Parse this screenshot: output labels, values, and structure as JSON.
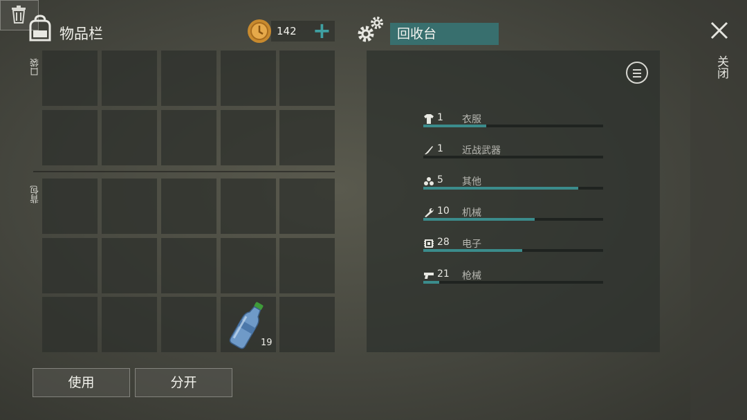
{
  "inventory": {
    "title": "物品栏",
    "coins": "142",
    "sections": {
      "pocket": "口袋",
      "backpack": "背包"
    },
    "item": {
      "name": "water-bottle",
      "quantity": "19"
    },
    "buttons": {
      "use": "使用",
      "split": "分开"
    }
  },
  "recycler": {
    "title": "回收台",
    "resources": [
      {
        "icon": "shirt-icon",
        "count": "1",
        "name": "衣服",
        "progress": 0.35
      },
      {
        "icon": "knife-icon",
        "count": "1",
        "name": "近战武器",
        "progress": 0.0
      },
      {
        "icon": "dots-icon",
        "count": "5",
        "name": "其他",
        "progress": 0.86
      },
      {
        "icon": "wrench-icon",
        "count": "10",
        "name": "机械",
        "progress": 0.62
      },
      {
        "icon": "chip-icon",
        "count": "28",
        "name": "电子",
        "progress": 0.55
      },
      {
        "icon": "gun-icon",
        "count": "21",
        "name": "枪械",
        "progress": 0.09
      }
    ]
  },
  "close": {
    "label": "关闭"
  },
  "colors": {
    "accent": "#3b8c8c",
    "title_bg": "#386f6e"
  }
}
